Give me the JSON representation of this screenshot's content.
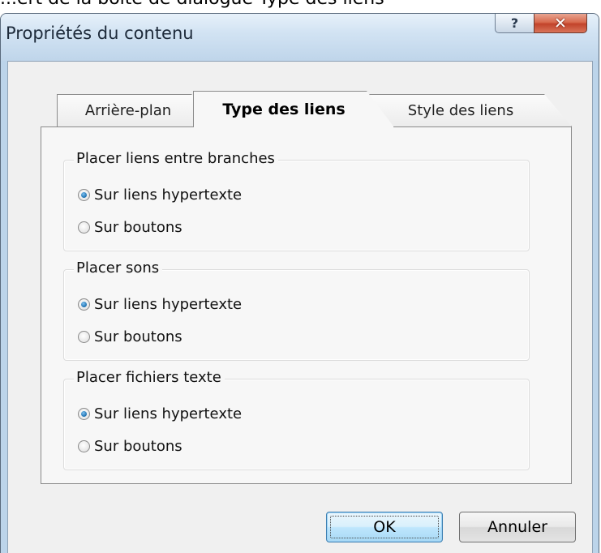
{
  "page": {
    "top_text": "...ert de la boîte de dialogue Type des liens"
  },
  "window": {
    "title": "Propriétés du contenu",
    "help_glyph": "?",
    "close_glyph": "✕"
  },
  "tabs": [
    {
      "label": "Arrière-plan",
      "active": false
    },
    {
      "label": "Type des liens",
      "active": true
    },
    {
      "label": "Style des liens",
      "active": false
    }
  ],
  "groups": [
    {
      "title": "Placer liens entre branches",
      "options": [
        {
          "label": "Sur liens hypertexte",
          "checked": true
        },
        {
          "label": "Sur boutons",
          "checked": false
        }
      ]
    },
    {
      "title": "Placer sons",
      "options": [
        {
          "label": "Sur liens hypertexte",
          "checked": true
        },
        {
          "label": "Sur boutons",
          "checked": false
        }
      ]
    },
    {
      "title": "Placer fichiers texte",
      "options": [
        {
          "label": "Sur liens hypertexte",
          "checked": true
        },
        {
          "label": "Sur boutons",
          "checked": false
        }
      ]
    }
  ],
  "buttons": {
    "ok_label": "OK",
    "cancel_label": "Annuler"
  },
  "colors": {
    "titlebar": "#bfd5ea",
    "close_button": "#c2432a",
    "ok_button": "#bee6fd"
  }
}
